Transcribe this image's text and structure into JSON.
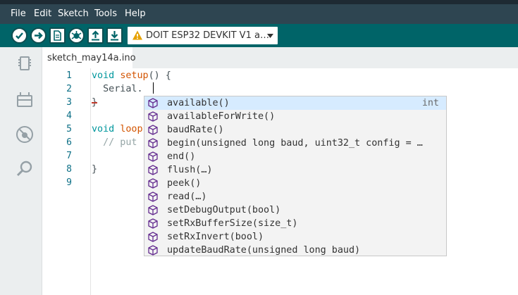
{
  "menu": [
    "File",
    "Edit",
    "Sketch",
    "Tools",
    "Help"
  ],
  "board": {
    "name": "DOIT ESP32 DEVKIT V1 a…"
  },
  "tab": {
    "filename": "sketch_may14a.ino"
  },
  "line_numbers": [
    "1",
    "2",
    "3",
    "4",
    "5",
    "6",
    "7",
    "8",
    "9"
  ],
  "code": {
    "void": "void",
    "setup": "setup",
    "setup_rest": "() {",
    "serial": "  Serial.",
    "close_brace": "}",
    "loop": "loop",
    "comment": "  // put",
    "close_brace2": "}"
  },
  "suggestions": [
    {
      "label": "available()",
      "type": "int"
    },
    {
      "label": "availableForWrite()",
      "type": ""
    },
    {
      "label": "baudRate()",
      "type": ""
    },
    {
      "label": "begin(unsigned long baud, uint32_t config = …",
      "type": ""
    },
    {
      "label": "end()",
      "type": ""
    },
    {
      "label": "flush(…)",
      "type": ""
    },
    {
      "label": "peek()",
      "type": ""
    },
    {
      "label": "read(…)",
      "type": ""
    },
    {
      "label": "setDebugOutput(bool)",
      "type": ""
    },
    {
      "label": "setRxBufferSize(size_t)",
      "type": ""
    },
    {
      "label": "setRxInvert(bool)",
      "type": ""
    },
    {
      "label": "updateBaudRate(unsigned long baud)",
      "type": ""
    }
  ],
  "colors": {
    "toolbar": "#006468",
    "menubar": "#2e4551",
    "accent": "#00979d",
    "selection": "#d6ebff"
  },
  "icons": {
    "toolbar": [
      "verify-icon",
      "upload-icon",
      "new-file-icon",
      "debug-icon",
      "open-icon",
      "save-icon"
    ],
    "sidebar": [
      "board-icon",
      "library-icon",
      "debug-icon",
      "search-icon"
    ],
    "suggestion": "method-cube-icon"
  }
}
